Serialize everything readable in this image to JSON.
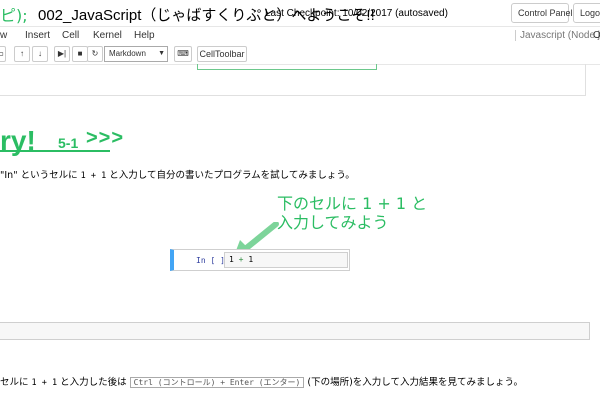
{
  "header": {
    "logo_fragment": "ピ);",
    "notebook_title": "002_JavaScript（じゃばすくりぷと）へようこそ!!",
    "checkpoint": "Last Checkpoint: 10/02/2017 (autosaved)",
    "control_panel_label": "Control Panel",
    "logout_label": "Logout"
  },
  "menubar": {
    "items": [
      "w",
      "Insert",
      "Cell",
      "Kernel",
      "Help"
    ],
    "kernel_name": "Javascript (Node.js)",
    "kernel_indicator": "O"
  },
  "toolbar": {
    "buttons": [
      {
        "name": "save",
        "glyph": "▭"
      },
      {
        "name": "run-above",
        "glyph": "🠕"
      },
      {
        "name": "move-up",
        "glyph": "↑"
      },
      {
        "name": "move-down",
        "glyph": "↓"
      },
      {
        "name": "run",
        "glyph": "⏭"
      },
      {
        "name": "stop",
        "glyph": "■"
      },
      {
        "name": "restart",
        "glyph": "↻"
      }
    ],
    "cell_type": "Markdown",
    "keyboard_glyph": "⌨",
    "celltoolbar_label": "CellToolbar"
  },
  "heading": {
    "main": "ry!",
    "sub": "5-1",
    "arrows": ">>>"
  },
  "instruction": {
    "prefix": "\"In\" というセルに ",
    "code": "1 + 1",
    "suffix": " と入力して自分の書いたプログラムを試してみましょう。"
  },
  "annotation": {
    "line1": "下のセルに 1 + 1 と",
    "line2": "入力してみよう"
  },
  "code_cell": {
    "prompt": "In [ ]:",
    "code_left": "1",
    "code_op": "+",
    "code_right": "1"
  },
  "bottom": {
    "prefix": "セルに ",
    "code": "1 + 1",
    "middle": " と入力した後は ",
    "kbd": "Ctrl (コントロール) + Enter (エンター)",
    "suffix": " (下の場所)を入力して入力結果を見てみましょう。"
  },
  "colors": {
    "accent_green": "#2bbd63",
    "cell_selected": "#42a5f5"
  }
}
